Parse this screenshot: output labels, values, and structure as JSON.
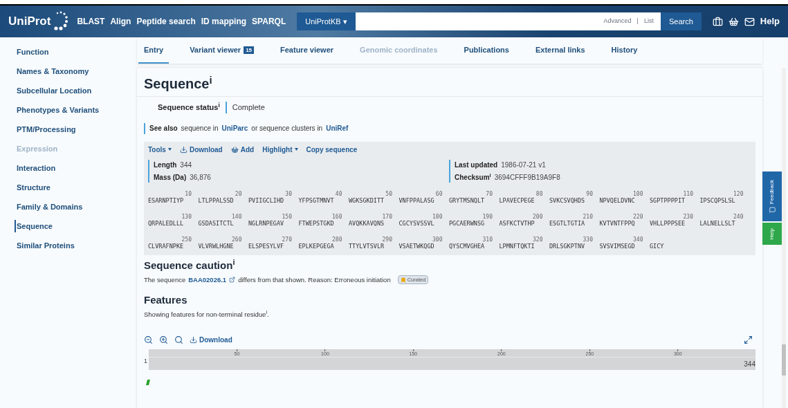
{
  "header": {
    "logo": "UniProt",
    "nav": [
      "BLAST",
      "Align",
      "Peptide search",
      "ID mapping",
      "SPARQL"
    ],
    "database": "UniProtKB ▾",
    "search_links": [
      "Advanced",
      "|",
      "List"
    ],
    "search_button": "Search",
    "help": "Help"
  },
  "sidebar": {
    "items": [
      {
        "label": "Function",
        "selected": false,
        "disabled": false
      },
      {
        "label": "Names & Taxonomy",
        "selected": false,
        "disabled": false
      },
      {
        "label": "Subcellular Location",
        "selected": false,
        "disabled": false
      },
      {
        "label": "Phenotypes & Variants",
        "selected": false,
        "disabled": false
      },
      {
        "label": "PTM/Processing",
        "selected": false,
        "disabled": false
      },
      {
        "label": "Expression",
        "selected": false,
        "disabled": true
      },
      {
        "label": "Interaction",
        "selected": false,
        "disabled": false
      },
      {
        "label": "Structure",
        "selected": false,
        "disabled": false
      },
      {
        "label": "Family & Domains",
        "selected": false,
        "disabled": false
      },
      {
        "label": "Sequence",
        "selected": true,
        "disabled": false
      },
      {
        "label": "Similar Proteins",
        "selected": false,
        "disabled": false
      }
    ]
  },
  "tabs": [
    {
      "label": "Entry",
      "selected": true,
      "disabled": false
    },
    {
      "label": "Variant viewer",
      "badge": "15",
      "selected": false,
      "disabled": false
    },
    {
      "label": "Feature viewer",
      "selected": false,
      "disabled": false
    },
    {
      "label": "Genomic coordinates",
      "selected": false,
      "disabled": true
    },
    {
      "label": "Publications",
      "selected": false,
      "disabled": false
    },
    {
      "label": "External links",
      "selected": false,
      "disabled": false
    },
    {
      "label": "History",
      "selected": false,
      "disabled": false
    }
  ],
  "sequence": {
    "title": "Sequence$^{i}$",
    "status_label": "Sequence status$^{i}$",
    "status_value": "Complete",
    "see_also": {
      "label": "See also",
      "parts": [
        {
          "text": "sequence in",
          "link": false
        },
        {
          "text": "UniParc",
          "link": true
        },
        {
          "text": "or sequence clusters in",
          "link": false
        },
        {
          "text": "UniRef",
          "link": true
        }
      ]
    },
    "tools": [
      {
        "label": "Tools",
        "kind": "menu"
      },
      {
        "label": "Download",
        "kind": "download"
      },
      {
        "label": "Add",
        "kind": "basket"
      },
      {
        "label": "Highlight",
        "kind": "menu"
      },
      {
        "label": "Copy sequence",
        "kind": "plain"
      }
    ],
    "facts_left": [
      {
        "label": "Length",
        "value": "344"
      },
      {
        "label": "Mass (Da)",
        "value": "36,876"
      }
    ],
    "facts_right": [
      {
        "label": "Last updated",
        "value": "1986-07-21 v1"
      },
      {
        "label": "Checksum$^{i}$",
        "value": "3694CFFF9B19A9F8"
      }
    ],
    "rows": [
      [
        {
          "num": "10",
          "seq": "ESARNPTIYP"
        },
        {
          "num": "20",
          "seq": "LTLPPALSSD"
        },
        {
          "num": "30",
          "seq": "PVIIGCLIHD"
        },
        {
          "num": "40",
          "seq": "YFPSGTMNVT"
        },
        {
          "num": "50",
          "seq": "WGKSGKDITT"
        },
        {
          "num": "60",
          "seq": "VNFPPALASG"
        },
        {
          "num": "70",
          "seq": "GRYTMSNQLT"
        },
        {
          "num": "80",
          "seq": "LPAVECPEGE"
        },
        {
          "num": "90",
          "seq": "SVKCSVQHDS"
        },
        {
          "num": "100",
          "seq": "NPVQELDVNC"
        },
        {
          "num": "110",
          "seq": "SGPTPPPPIT"
        },
        {
          "num": "120",
          "seq": "IPSCQPSLSL"
        }
      ],
      [
        {
          "num": "130",
          "seq": "QRPALEDLLL"
        },
        {
          "num": "140",
          "seq": "GSDASITCTL"
        },
        {
          "num": "150",
          "seq": "NGLRNPEGAV"
        },
        {
          "num": "160",
          "seq": "FTWEPSTGKD"
        },
        {
          "num": "170",
          "seq": "AVQKKAVQNS"
        },
        {
          "num": "180",
          "seq": "CGCYSVSSVL"
        },
        {
          "num": "190",
          "seq": "PGCAERWNSG"
        },
        {
          "num": "200",
          "seq": "ASFKCTVTHP"
        },
        {
          "num": "210",
          "seq": "ESGTLTGTIA"
        },
        {
          "num": "220",
          "seq": "KVTVNTFPPQ"
        },
        {
          "num": "230",
          "seq": "VHLLPPPSEE"
        },
        {
          "num": "240",
          "seq": "LALNELLSLT"
        }
      ],
      [
        {
          "num": "250",
          "seq": "CLVRAFNPKE"
        },
        {
          "num": "260",
          "seq": "VLVRWLHGNE"
        },
        {
          "num": "270",
          "seq": "ELSPESYLVF"
        },
        {
          "num": "280",
          "seq": "EPLKEPGEGA"
        },
        {
          "num": "290",
          "seq": "TTYLVTSVLR"
        },
        {
          "num": "300",
          "seq": "VSAETWKQGD"
        },
        {
          "num": "310",
          "seq": "QYSCMVGHEA"
        },
        {
          "num": "320",
          "seq": "LPMNFTQKTI"
        },
        {
          "num": "330",
          "seq": "DRLSGKPTNV"
        },
        {
          "num": "340",
          "seq": "SVSVIMSEGD"
        },
        {
          "seq": "GICY"
        }
      ]
    ]
  },
  "caution": {
    "title": "Sequence caution$^{i}$",
    "before": "The sequence",
    "link": "BAA02026.1",
    "after": "differs from that shown. Reason: Erroneous initiation",
    "badge": "Curated"
  },
  "features": {
    "title": "Features",
    "note": "Showing features for non-terminal residue$^{i}$.",
    "download": "Download",
    "start": "1",
    "end": "344",
    "ticks": [
      "50",
      "100",
      "150",
      "200",
      "250",
      "300"
    ]
  },
  "side_tabs": [
    "Feedback",
    "Help"
  ]
}
